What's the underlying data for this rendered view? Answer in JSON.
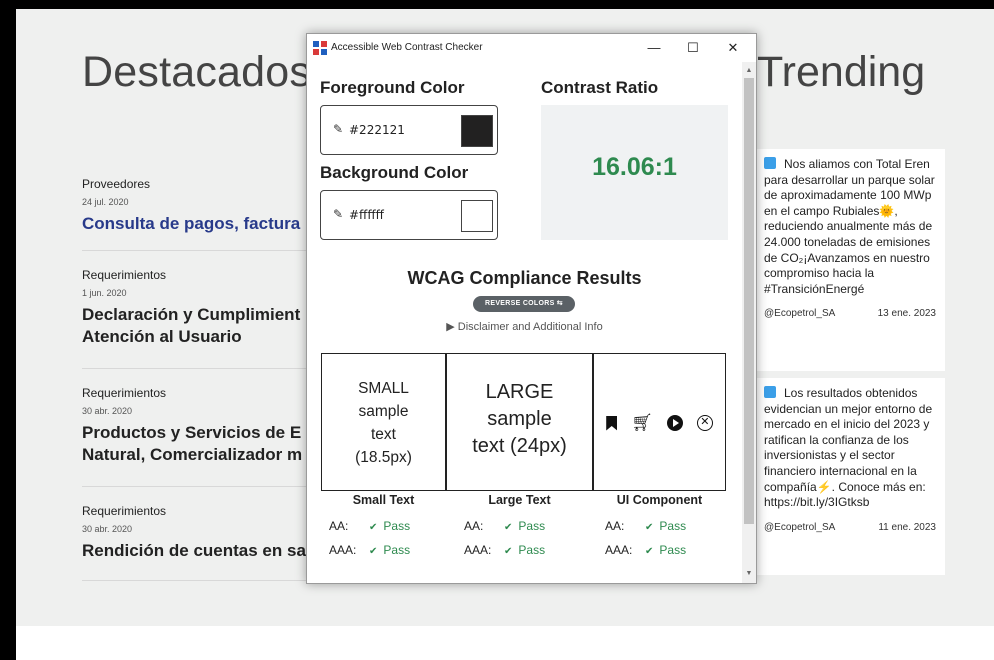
{
  "site": {
    "heading_left": "Destacados",
    "heading_right": "Trending",
    "news": [
      {
        "category": "Proveedores",
        "date": "24 jul. 2020",
        "title": "Consulta de pagos, factura"
      },
      {
        "category": "Requerimientos",
        "date": "1 jun. 2020",
        "title_line1": "Declaración y Cumplimient",
        "title_line2": "Atención al Usuario"
      },
      {
        "category": "Requerimientos",
        "date": "30 abr. 2020",
        "title_line1": "Productos y Servicios de E",
        "title_line2": "Natural, Comercializador m"
      },
      {
        "category": "Requerimientos",
        "date": "30 abr. 2020",
        "title": "Rendición de cuentas en sa"
      }
    ],
    "tweets": [
      {
        "text_before": "Nos aliamos con Total Eren para desarrollar un parque solar de aproximadamente 100 MWp en el campo Rubiales",
        "emoji": "🌞",
        "text_after": ", reduciendo anualmente más de 24.000 toneladas de emisiones de CO₂¡Avanzamos en nuestro compromiso hacia la #TransiciónEnergé",
        "handle": "@Ecopetrol_SA",
        "date": "13 ene. 2023"
      },
      {
        "text_before": "Los resultados obtenidos evidencian un mejor entorno de mercado en el inicio del 2023 y ratifican la confianza de los inversionistas y el sector financiero internacional en la compañía",
        "emoji": "⚡",
        "text_after": ". Conoce más en: https://bit.ly/3IGtksb",
        "handle": "@Ecopetrol_SA",
        "date": "11 ene. 2023"
      }
    ]
  },
  "window": {
    "title": "Accessible Web Contrast Checker",
    "minimize": "—",
    "maximize": "☐",
    "close": "✕",
    "foreground_label": "Foreground Color",
    "foreground_value": "#222121",
    "background_label": "Background Color",
    "background_value": "#ffffff",
    "contrast_label": "Contrast Ratio",
    "contrast_value": "16.06:1",
    "wcag_title": "WCAG Compliance Results",
    "reverse_button": "REVERSE COLORS ⇆",
    "disclaimer": "▶ Disclaimer and Additional Info",
    "samples": {
      "small_lines": [
        "SMALL",
        "sample",
        "text",
        "(18.5px)"
      ],
      "large_lines": [
        "LARGE",
        "sample",
        "text (24px)"
      ]
    },
    "columns": [
      {
        "heading": "Small Text",
        "aa_label": "AA:",
        "aa": "Pass",
        "aaa_label": "AAA:",
        "aaa": "Pass"
      },
      {
        "heading": "Large Text",
        "aa_label": "AA:",
        "aa": "Pass",
        "aaa_label": "AAA:",
        "aaa": "Pass"
      },
      {
        "heading": "UI Component",
        "aa_label": "AA:",
        "aa": "Pass",
        "aaa_label": "AAA:",
        "aaa": "Pass"
      }
    ],
    "colors": {
      "pass": "#2e8a4f",
      "foreground": "#222121",
      "background": "#ffffff"
    }
  }
}
